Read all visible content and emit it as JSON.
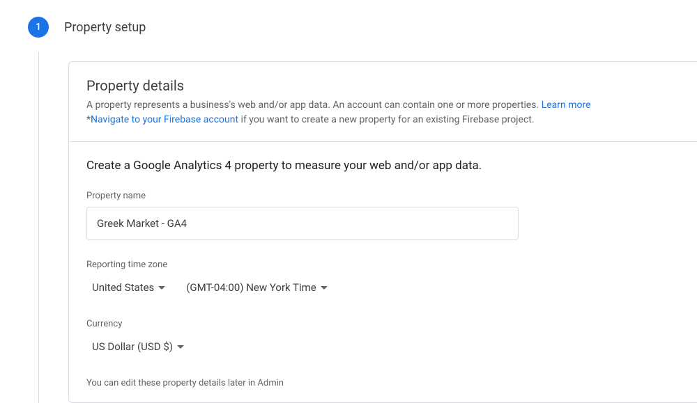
{
  "stepper": {
    "number": "1",
    "title": "Property setup"
  },
  "header": {
    "title": "Property details",
    "desc_part1": "A property represents a business's web and/or app data. An account can contain one or more properties. ",
    "learn_more": "Learn more",
    "desc_part2a": "*",
    "navigate_link": "Navigate to your Firebase account",
    "desc_part2b": " if you want to create a new property for an existing Firebase project."
  },
  "body": {
    "heading": "Create a Google Analytics 4 property to measure your web and/or app data.",
    "property_name_label": "Property name",
    "property_name_value": "Greek Market - GA4",
    "timezone_label": "Reporting time zone",
    "country_value": "United States",
    "timezone_value": "(GMT-04:00) New York Time",
    "currency_label": "Currency",
    "currency_value": "US Dollar (USD $)",
    "hint": "You can edit these property details later in Admin"
  }
}
